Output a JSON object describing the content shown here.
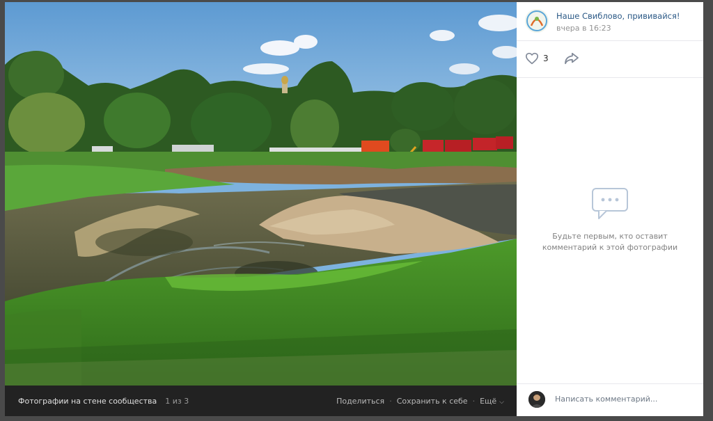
{
  "post": {
    "author": "Наше Свиблово, прививайся!",
    "date": "вчера в 16:23",
    "likes": "3"
  },
  "empty_comments": {
    "line1": "Будьте первым, кто оставит",
    "line2": "комментарий к этой фотографии"
  },
  "comment": {
    "placeholder": "Написать комментарий..."
  },
  "footer": {
    "title": "Фотографии на стене сообщества",
    "counter": "1 из 3",
    "share": "Поделиться",
    "save": "Сохранить к себе",
    "more": "Ещё"
  },
  "icons": {
    "like": "heart-icon",
    "share": "share-arrow-icon",
    "empty": "comments-bubble-icon",
    "more": "chevron-down-icon"
  },
  "colors": {
    "link": "#2a5885",
    "muted": "#939393",
    "footer_bg": "#222222"
  }
}
